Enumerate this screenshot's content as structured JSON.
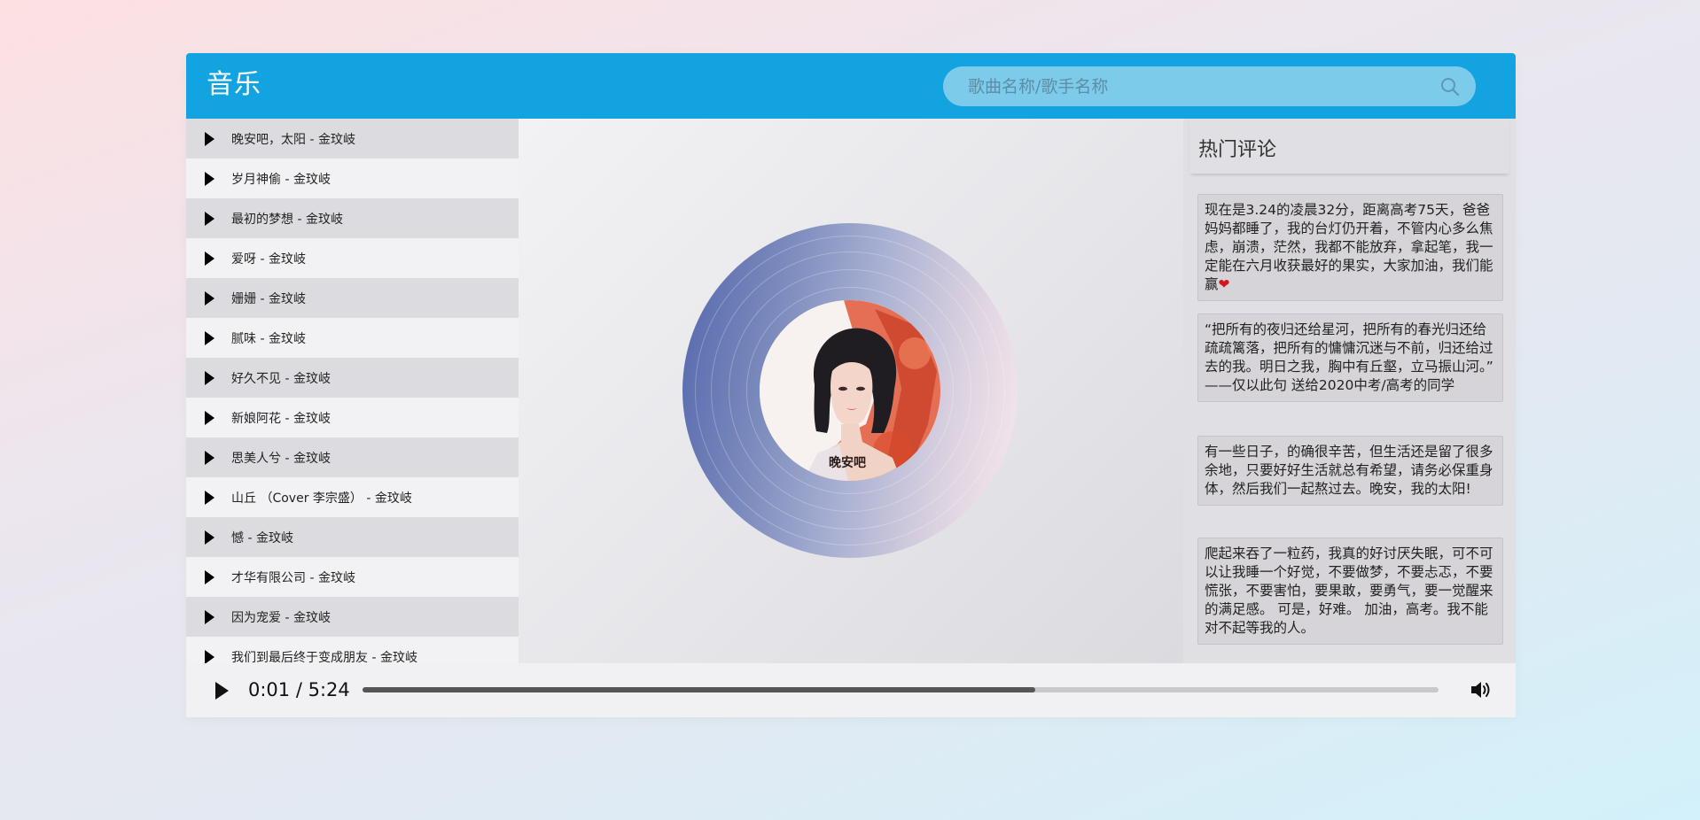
{
  "header": {
    "title": "音乐",
    "search_placeholder": "歌曲名称/歌手名称",
    "search_icon": "search-icon"
  },
  "playlist": {
    "songs": [
      "晚安吧，太阳 - 金玟岐",
      "岁月神偷 - 金玟岐",
      "最初的梦想 - 金玟岐",
      "爱呀 - 金玟岐",
      "姗姗 - 金玟岐",
      "腻味 - 金玟岐",
      "好久不见 - 金玟岐",
      "新娘阿花 - 金玟岐",
      "思美人兮 - 金玟岐",
      "山丘 （Cover 李宗盛） - 金玟岐",
      "憾 - 金玟岐",
      "才华有限公司 - 金玟岐",
      "因为宠爱 - 金玟岐",
      "我们到最后终于变成朋友 - 金玟岐"
    ],
    "item_icon": "play-triangle-icon"
  },
  "comments": {
    "title": "热门评论",
    "items": [
      "现在是3.24的凌晨32分，距离高考75天，爸爸妈妈都睡了，我的台灯仍开着，不管内心多么焦虑，崩溃，茫然，我都不能放弃，拿起笔，我一定能在六月收获最好的果实，大家加油，我们能赢",
      "“把所有的夜归还给星河，把所有的春光归还给疏疏篱落，把所有的慵慵沉迷与不前，归还给过去的我。明日之我，胸中有丘壑，立马振山河。” ——仅以此句 送给2020中考/高考的同学",
      "有一些日子，的确很辛苦，但生活还是留了很多余地，只要好好生活就总有希望，请务必保重身体，然后我们一起熬过去。晚安，我的太阳!",
      "爬起来吞了一粒药，我真的好讨厌失眠，可不可以让我睡一个好觉，不要做梦，不要忐忑，不要慌张，不要害怕，要果敢，要勇气，要一觉醒来的满足感。 可是，好难。 加油，高考。我不能对不起等我的人。"
    ],
    "heart_glyph": "❤"
  },
  "player": {
    "current_time": "0:01",
    "separator": " / ",
    "duration": "5:24",
    "progress": 0.625,
    "play_icon": "play-icon",
    "volume_icon": "volume-icon"
  },
  "colors": {
    "header_bg": "#13a3e0",
    "search_bg": "#7dcbea",
    "heart": "#d5151c"
  }
}
